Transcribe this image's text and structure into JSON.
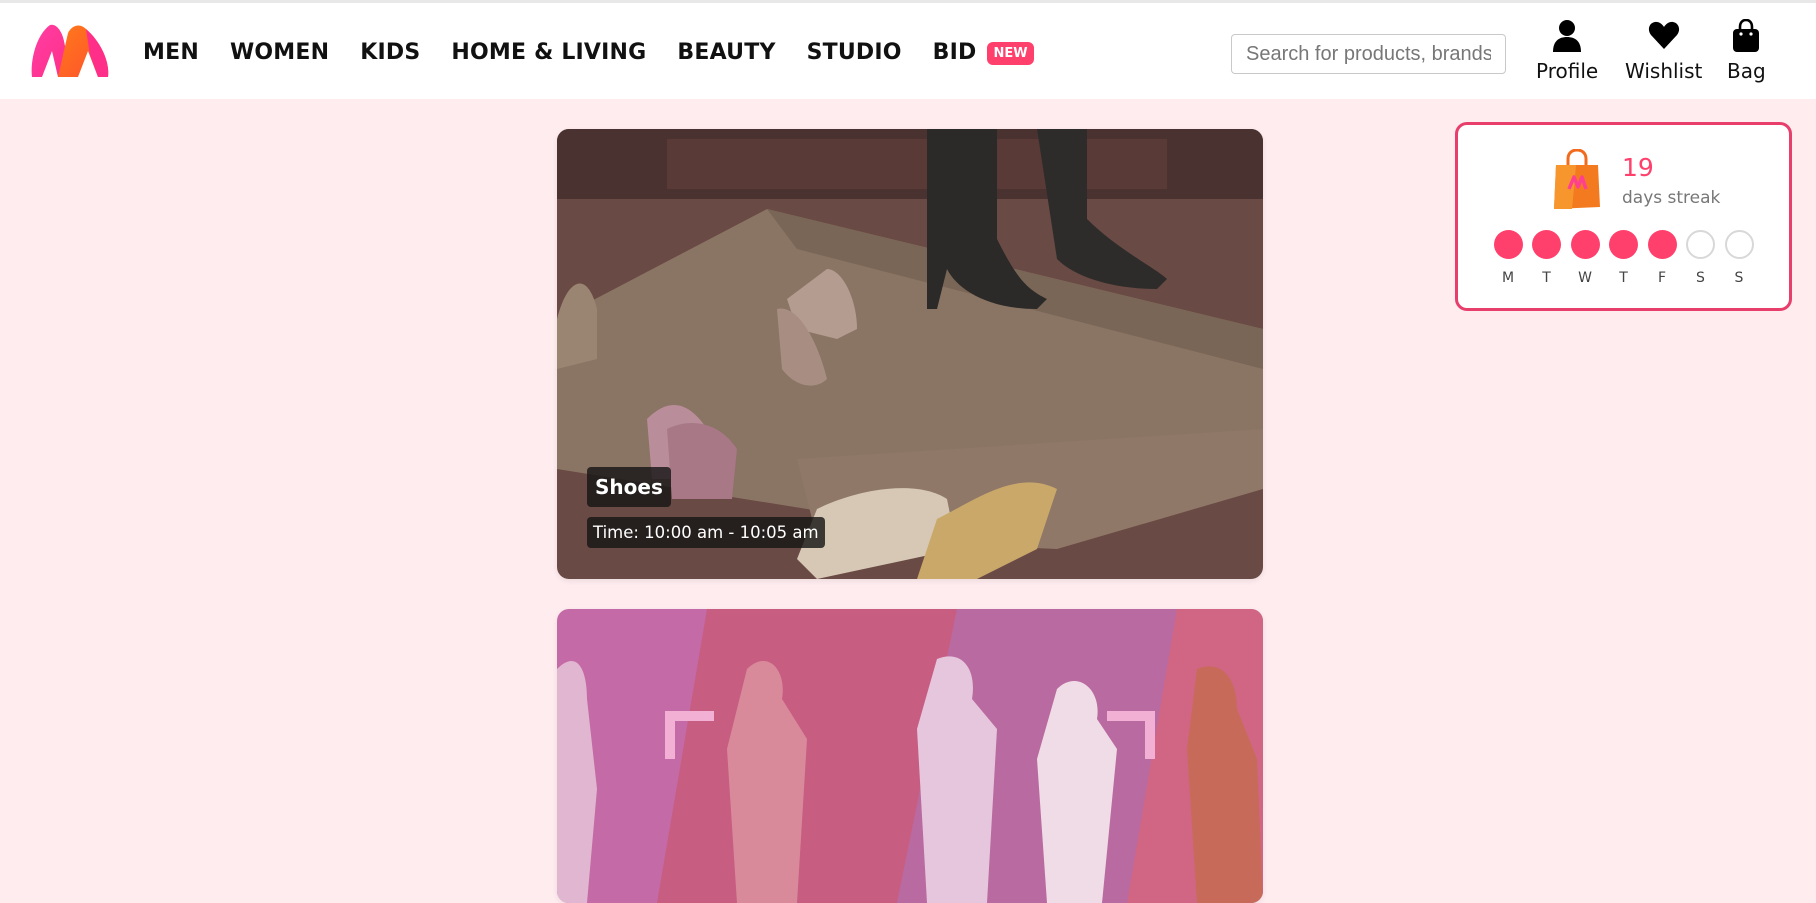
{
  "header": {
    "nav": [
      {
        "label": "MEN"
      },
      {
        "label": "WOMEN"
      },
      {
        "label": "KIDS"
      },
      {
        "label": "HOME & LIVING"
      },
      {
        "label": "BEAUTY"
      },
      {
        "label": "STUDIO"
      },
      {
        "label": "BID"
      }
    ],
    "bid_badge": "NEW",
    "search": {
      "placeholder": "Search for products, brands and more",
      "value": ""
    },
    "actions": {
      "profile": "Profile",
      "wishlist": "Wishlist",
      "bag": "Bag"
    }
  },
  "cards": [
    {
      "title": "Shoes",
      "time": "Time: 10:00 am - 10:05 am"
    }
  ],
  "streak": {
    "count": "19",
    "label": "days streak",
    "days": [
      {
        "letter": "M",
        "done": true
      },
      {
        "letter": "T",
        "done": true
      },
      {
        "letter": "W",
        "done": true
      },
      {
        "letter": "T",
        "done": true
      },
      {
        "letter": "F",
        "done": true
      },
      {
        "letter": "S",
        "done": false
      },
      {
        "letter": "S",
        "done": false
      }
    ]
  },
  "colors": {
    "accent": "#ff3f6c",
    "page_background": "#feecef"
  },
  "icons": [
    "myntra-logo",
    "profile-icon",
    "heart-icon",
    "bag-icon",
    "shopping-bag-icon"
  ]
}
